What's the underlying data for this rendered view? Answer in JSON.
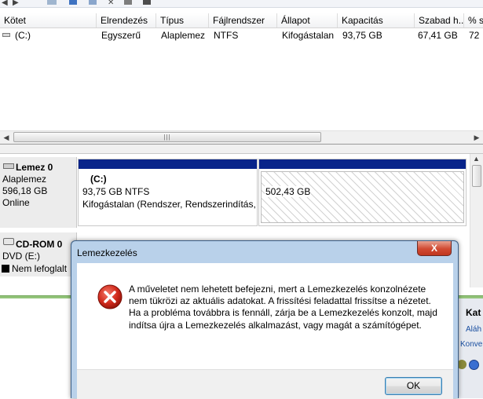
{
  "toolbar": {
    "icons": [
      "back-icon",
      "forward-icon",
      "show-icon",
      "help-icon",
      "delete-icon",
      "properties-icon"
    ]
  },
  "volume_list": {
    "headers": [
      "Kötet",
      "Elrendezés",
      "Típus",
      "Fájlrendszer",
      "Állapot",
      "Kapacitás",
      "Szabad h...",
      "% s"
    ],
    "rows": [
      {
        "kotet": "(C:)",
        "elrendezes": "Egyszerű",
        "tipus": "Alaplemez",
        "fajlrendszer": "NTFS",
        "allapot": "Kifogástalan ...",
        "kapacitas": "93,75 GB",
        "szabad": "67,41 GB",
        "szazalek": "72"
      }
    ]
  },
  "disks": [
    {
      "name": "Lemez 0",
      "type": "Alaplemez",
      "size": "596,18 GB",
      "status": "Online"
    },
    {
      "name": "CD-ROM 0",
      "type": "DVD (E:)",
      "status": "Nem lefoglalt"
    }
  ],
  "partitions": {
    "c": {
      "name": "(C:)",
      "size_fs": "93,75 GB NTFS",
      "status": "Kifogástalan (Rendszer, Rendszerindítás, l"
    },
    "unallocated": {
      "size": "502,43 GB"
    }
  },
  "right_pane": {
    "title": "Kat",
    "line1": "Aláh",
    "line2": "Konver"
  },
  "dialog": {
    "title": "Lemezkezelés",
    "message": "A műveletet nem lehetett befejezni, mert a Lemezkezelés konzolnézete nem tükrözi az aktuális adatokat. A frissítési feladattal frissítse a nézetet. Ha a probléma továbbra is fennáll, zárja be a Lemezkezelés konzolt, majd indítsa újra a Lemezkezelés alkalmazást, vagy magát a számítógépet.",
    "ok_label": "OK",
    "close_label": "X"
  },
  "colors": {
    "partition_bar": "#08248a",
    "dialog_frame": "#b9d1ea",
    "legend": "#93c47a",
    "error_red": "#c8241a"
  }
}
